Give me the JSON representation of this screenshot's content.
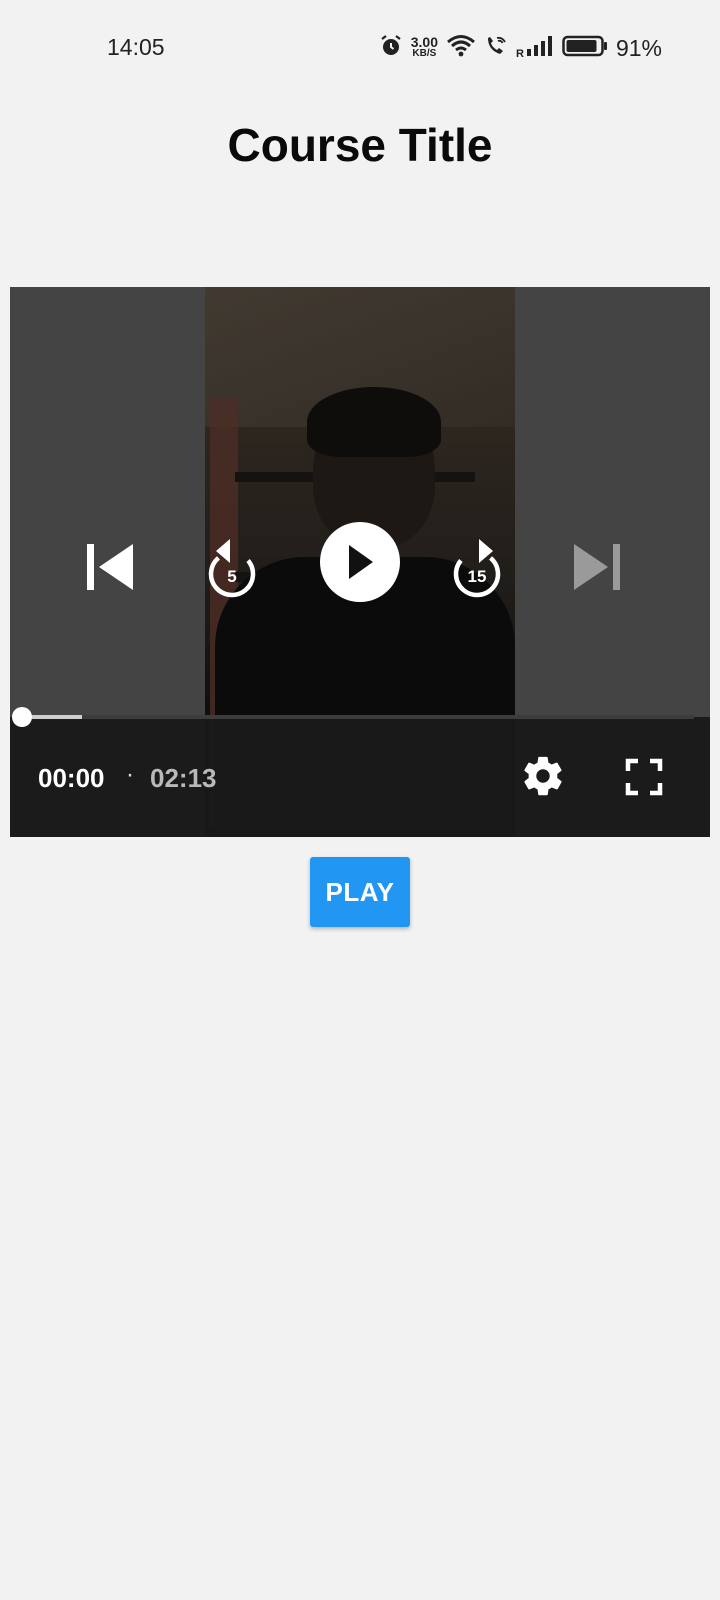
{
  "status_bar": {
    "time": "14:05",
    "net_speed_value": "3.00",
    "net_speed_unit": "KB/S",
    "roaming_label": "R",
    "battery_percent": "91%",
    "battery_level": 0.91,
    "icons": [
      "alarm-icon",
      "wifi-icon",
      "wifi-calling-icon",
      "signal-icon",
      "battery-icon"
    ]
  },
  "page": {
    "title": "Course Title"
  },
  "player": {
    "current_time": "00:00",
    "separator": "·",
    "total_time": "02:13",
    "progress": 0,
    "buffered": 0.09,
    "rewind_seconds": "5",
    "forward_seconds": "15",
    "icons": [
      "skip-previous-icon",
      "replay-5-icon",
      "play-icon",
      "forward-15-icon",
      "skip-next-icon",
      "settings-icon",
      "fullscreen-icon"
    ]
  },
  "actions": {
    "play_label": "PLAY"
  },
  "colors": {
    "background": "#f2f2f3",
    "accent": "#2196f3",
    "player_bg": "#5f5f5f",
    "control_bar": "#191919"
  }
}
